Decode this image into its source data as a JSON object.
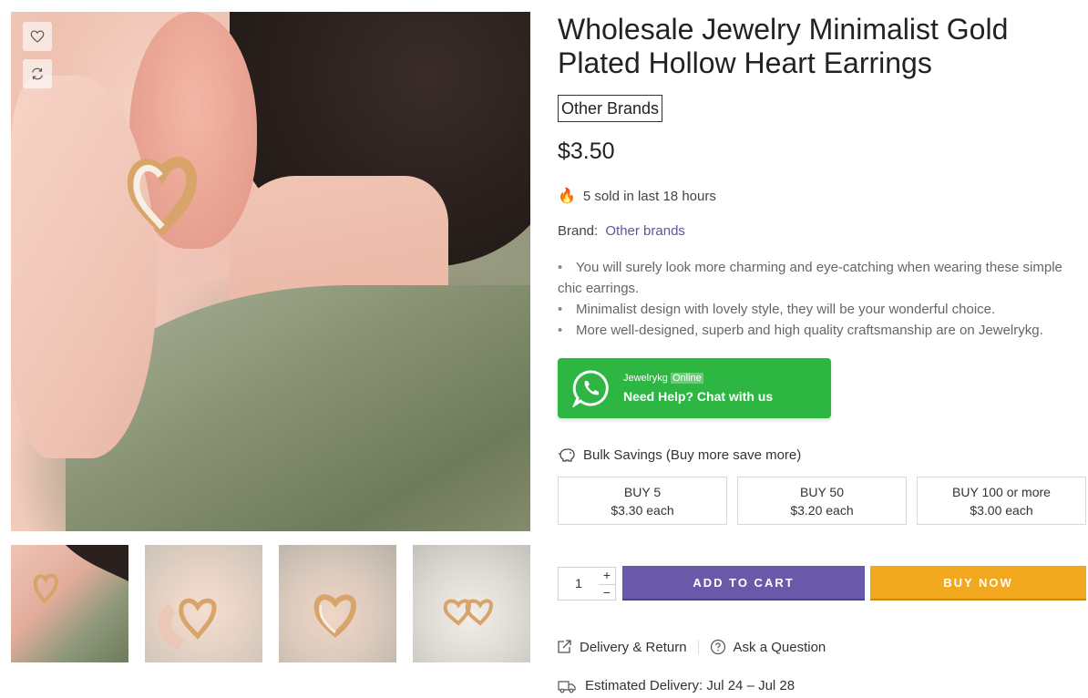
{
  "product": {
    "title": "Wholesale Jewelry Minimalist Gold Plated Hollow Heart Earrings",
    "brand_badge": "Other Brands",
    "price": "$3.50",
    "sold_text": "5 sold in last 18 hours",
    "brand_label": "Brand:",
    "brand_link": "Other brands",
    "bullets": [
      "You will surely look more charming and eye-catching when wearing these simple chic earrings.",
      "Minimalist design with lovely style, they will be your wonderful choice.",
      "More well-designed, superb and high quality craftsmanship are on Jewelrykg."
    ]
  },
  "whatsapp": {
    "name": "Jewelrykg",
    "status": "Online",
    "cta": "Need Help? Chat with us",
    "icon": "whatsapp-icon",
    "color": "#2db742"
  },
  "bulk": {
    "title": "Bulk Savings (Buy more save more)",
    "icon": "piggy-bank-icon",
    "tiers": [
      {
        "qty": "BUY 5",
        "price": "$3.30 each"
      },
      {
        "qty": "BUY 50",
        "price": "$3.20 each"
      },
      {
        "qty": "BUY 100 or more",
        "price": "$3.00 each"
      }
    ]
  },
  "purchase": {
    "quantity": "1",
    "plus": "+",
    "minus": "−",
    "add_to_cart": "ADD TO CART",
    "buy_now": "BUY NOW",
    "cart_color": "#6a59a8",
    "buy_color": "#f2a81e"
  },
  "links": {
    "delivery_return": "Delivery & Return",
    "ask_question": "Ask a Question",
    "estimated_delivery": "Estimated Delivery: Jul 24 – Jul 28"
  },
  "gallery": {
    "icons": [
      "heart-icon",
      "compare-icon"
    ],
    "thumbnails": 4
  }
}
